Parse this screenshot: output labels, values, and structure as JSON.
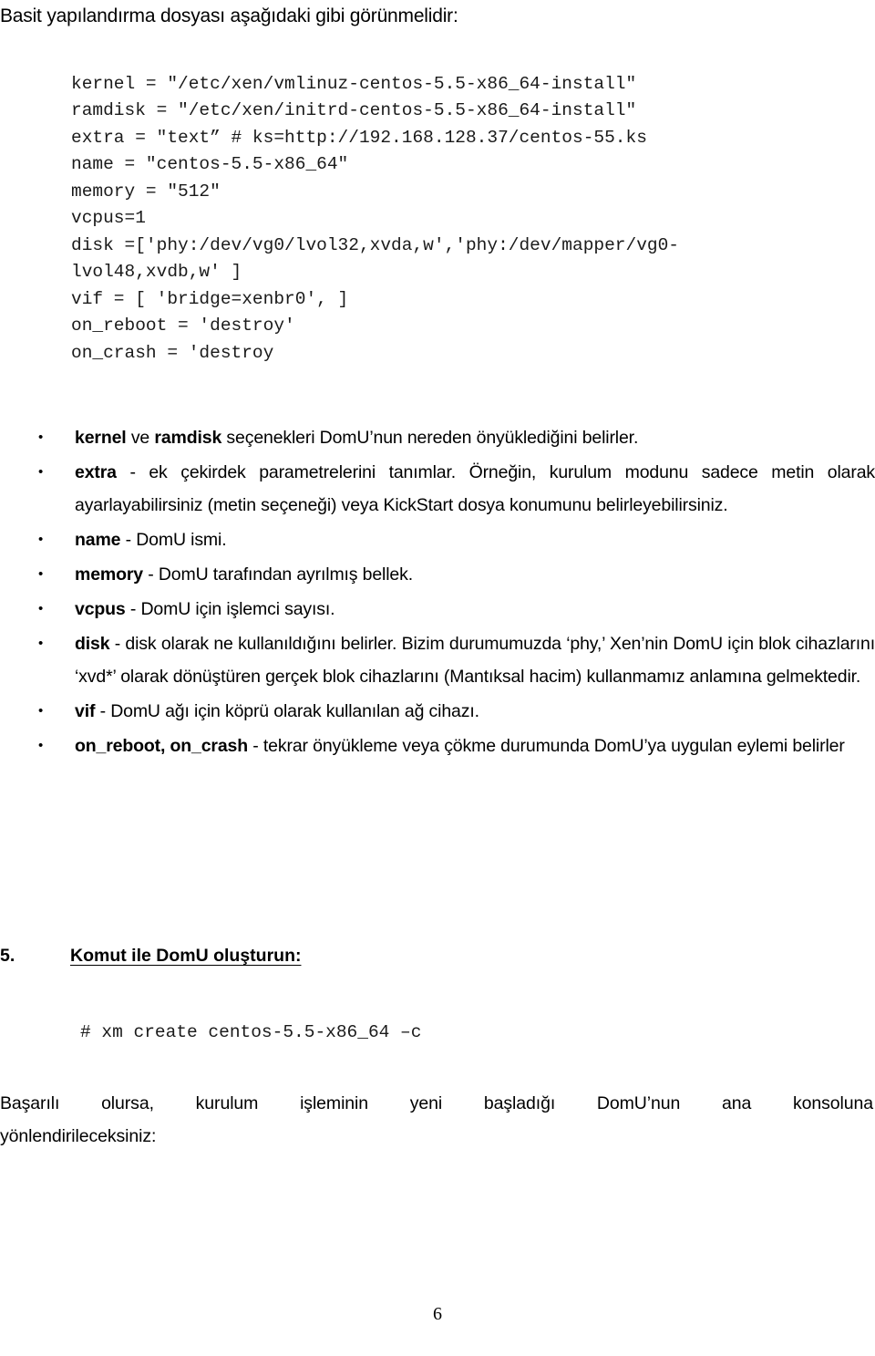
{
  "document": {
    "intro_heading": "Basit yapılandırma dosyası aşağıdaki gibi görünmelidir:",
    "config_code": {
      "lines": [
        "kernel = \"/etc/xen/vmlinuz-centos-5.5-x86_64-install\"",
        "ramdisk = \"/etc/xen/initrd-centos-5.5-x86_64-install\"",
        "extra = \"text” # ks=http://192.168.128.37/centos-55.ks",
        "name = \"centos-5.5-x86_64\"",
        "memory = \"512\"",
        "vcpus=1",
        "disk =['phy:/dev/vg0/lvol32,xvda,w','phy:/dev/mapper/vg0-lvol48,xvdb,w' ]",
        "vif = [ 'bridge=xenbr0', ]",
        "on_reboot = 'destroy'",
        "on_crash = 'destroy"
      ]
    },
    "bullets": [
      {
        "term": "kernel ve ramdisk",
        "term_parts": [
          "kernel",
          " ve ",
          "ramdisk"
        ],
        "text": " seçenekleri DomU’nun nereden önyüklediğini belirler."
      },
      {
        "term": "extra",
        "text": " - ek çekirdek parametrelerini tanımlar. Örneğin, kurulum modunu sadece metin olarak ayarlayabilirsiniz (metin seçeneği) veya KickStart dosya konumunu belirleyebilirsiniz."
      },
      {
        "term": "name",
        "text": " - DomU ismi."
      },
      {
        "term": "memory",
        "text": " - DomU tarafından ayrılmış bellek."
      },
      {
        "term": "vcpus",
        "text": " - DomU için işlemci sayısı."
      },
      {
        "term": "disk",
        "text": " - disk olarak ne kullanıldığını belirler. Bizim durumumuzda ‘phy,’ Xen’nin DomU için blok cihazlarını ‘xvd*’ olarak dönüştüren  gerçek blok cihazlarını (Mantıksal hacim) kullanmamız anlamına gelmektedir."
      },
      {
        "term": "vif",
        "text": " - DomU ağı için köprü olarak kullanılan ağ cihazı."
      },
      {
        "term": "on_reboot, on_crash",
        "text": " - tekrar önyükleme veya çökme durumunda  DomU’ya uygulan eylemi belirler"
      }
    ],
    "numbered_section": {
      "number": "5.",
      "heading": "Komut ile DomU oluşturun:"
    },
    "command_code": {
      "lines": [
        "# xm create centos-5.5-x86_64 –c"
      ]
    },
    "closing_paragraph": {
      "line_1": "Başarılı olursa, kurulum işleminin yeni başladığı DomU’nun ana konsoluna",
      "line_2": "yönlendirileceksiniz:"
    },
    "footer": {
      "page_number": "6"
    }
  }
}
